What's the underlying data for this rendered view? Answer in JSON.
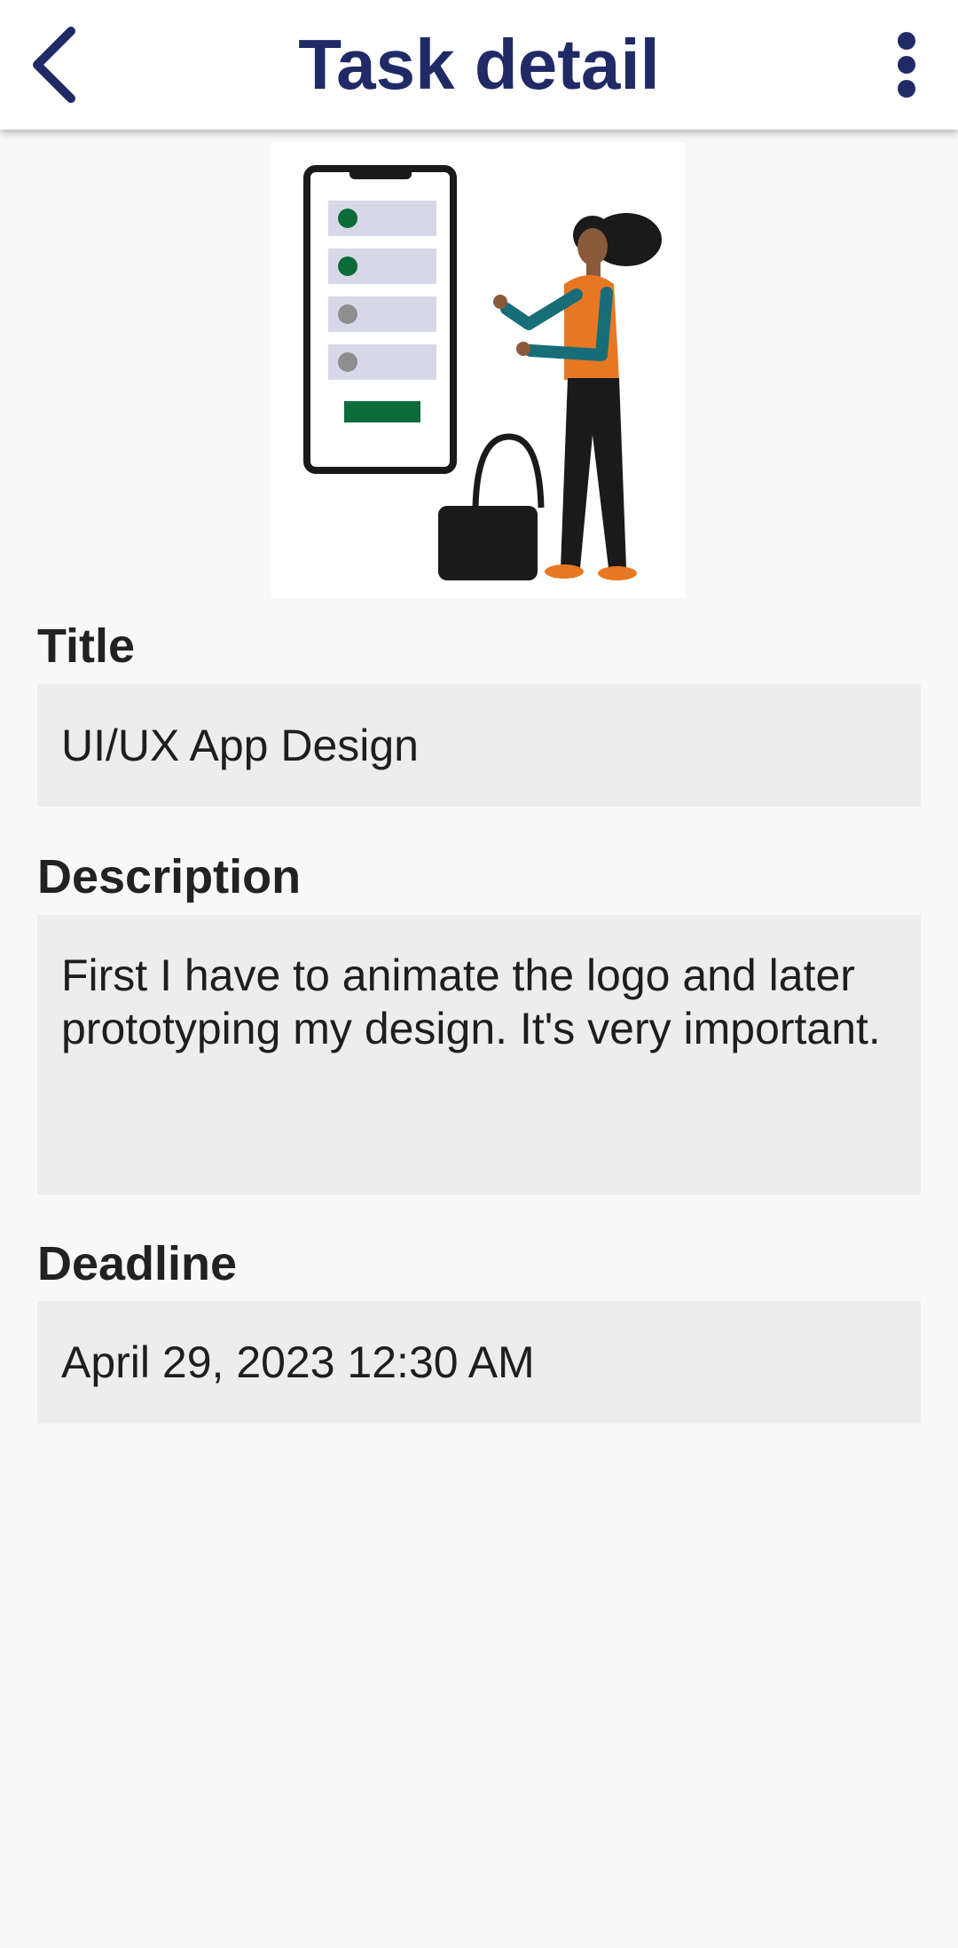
{
  "app_bar": {
    "title": "Task detail",
    "back_icon": "chevron-left-icon",
    "more_icon": "more-vertical-icon",
    "accent_color": "#1f2a66"
  },
  "illustration": {
    "icon": "task-checklist-illustration",
    "colors": {
      "green": "#0b6b3a",
      "orange": "#e87722",
      "teal": "#176d78",
      "dark": "#1a1a1a"
    }
  },
  "fields": {
    "title": {
      "label": "Title",
      "value": "UI/UX App Design"
    },
    "description": {
      "label": "Description",
      "value": "First I have to animate the logo and later prototyping my design. It's very important."
    },
    "deadline": {
      "label": "Deadline",
      "value": "April 29, 2023 12:30 AM"
    }
  }
}
